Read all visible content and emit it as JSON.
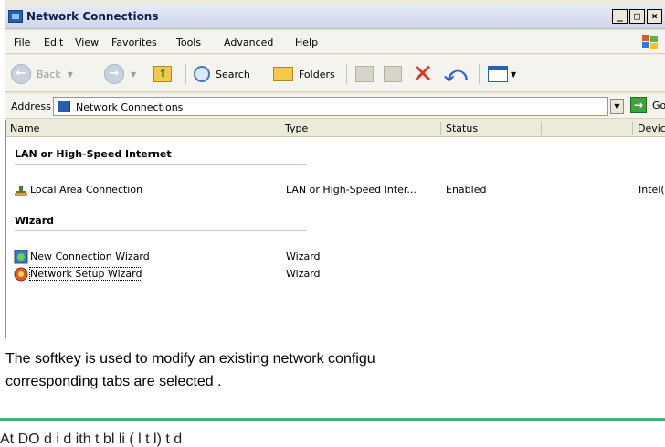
{
  "window": {
    "title": "Network Connections",
    "controls": {
      "minimize": "_",
      "maximize": "□",
      "close": "×"
    }
  },
  "menu": [
    "File",
    "Edit",
    "View",
    "Favorites",
    "Tools",
    "Advanced",
    "Help"
  ],
  "toolbar": {
    "back": "Back",
    "search": "Search",
    "folders": "Folders"
  },
  "address": {
    "label": "Address",
    "value": "Network Connections",
    "go": "Go"
  },
  "columns": [
    "Name",
    "Type",
    "Status",
    "Device Nar"
  ],
  "groups": [
    {
      "label": "LAN or High-Speed Internet",
      "items": [
        {
          "name": "Local Area Connection",
          "type": "LAN or High-Speed Inter...",
          "status": "Enabled",
          "device": "Intel(R) PR",
          "icon": "lan-connection-icon"
        }
      ]
    },
    {
      "label": "Wizard",
      "items": [
        {
          "name": "New Connection Wizard",
          "type": "Wizard",
          "status": "",
          "device": "",
          "icon": "new-connection-wizard-icon"
        },
        {
          "name": "Network Setup Wizard",
          "type": "Wizard",
          "status": "",
          "device": "",
          "icon": "network-setup-wizard-icon"
        }
      ]
    }
  ],
  "caption": {
    "line1": "The  softkey  is  used  to  modify  an  existing  network  configu",
    "line2": "corresponding tabs are selected ."
  },
  "cut_text": "At DO  d    i    d    ith  t   bl   li  (    l   t   l)  t  d"
}
